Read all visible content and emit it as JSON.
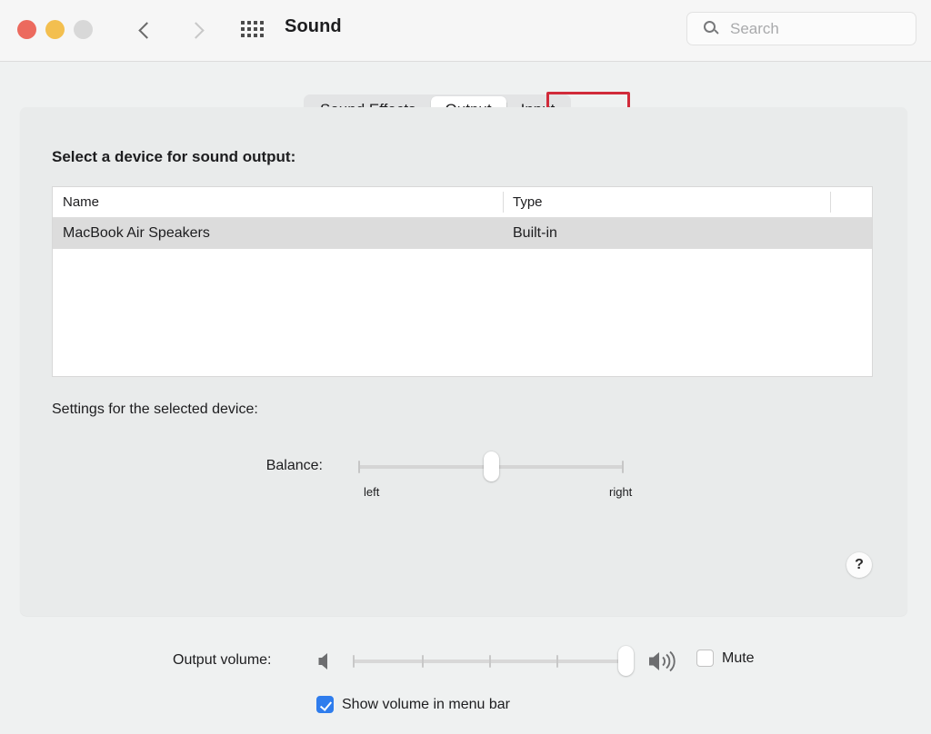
{
  "window": {
    "title": "Sound",
    "traffic_lights": [
      {
        "name": "close",
        "color": "#ec6a5e"
      },
      {
        "name": "minimize",
        "color": "#f3bf4f"
      },
      {
        "name": "zoom",
        "color": "#d8d8d8"
      }
    ]
  },
  "toolbar": {
    "back_icon": "chevron-left-icon",
    "forward_icon": "chevron-right-icon",
    "grid_icon": "grid-apps-icon",
    "search": {
      "icon": "search-icon",
      "value": "",
      "placeholder": "Search"
    }
  },
  "tabs": [
    {
      "label": "Sound Effects",
      "selected": false
    },
    {
      "label": "Output",
      "selected": true
    },
    {
      "label": "Input",
      "selected": false,
      "highlighted": true
    }
  ],
  "annotation": {
    "target": "Input",
    "color": "#d12b3a"
  },
  "panel": {
    "heading": "Select a device for sound output:",
    "table": {
      "columns": [
        "Name",
        "Type"
      ],
      "rows": [
        {
          "name": "MacBook Air Speakers",
          "type": "Built-in",
          "selected": true
        }
      ]
    },
    "settings_label": "Settings for the selected device:",
    "balance": {
      "label": "Balance:",
      "left_label": "left",
      "right_label": "right",
      "value_percent": 50
    },
    "help": {
      "icon": "question-mark-icon",
      "glyph": "?"
    }
  },
  "bottom": {
    "output_volume_label": "Output volume:",
    "quiet_icon": "speaker-quiet-icon",
    "loud_icon": "speaker-loud-icon",
    "volume_percent": 97,
    "mute": {
      "label": "Mute",
      "checked": false
    },
    "show_volume": {
      "label": "Show volume in menu bar",
      "checked": true
    }
  }
}
